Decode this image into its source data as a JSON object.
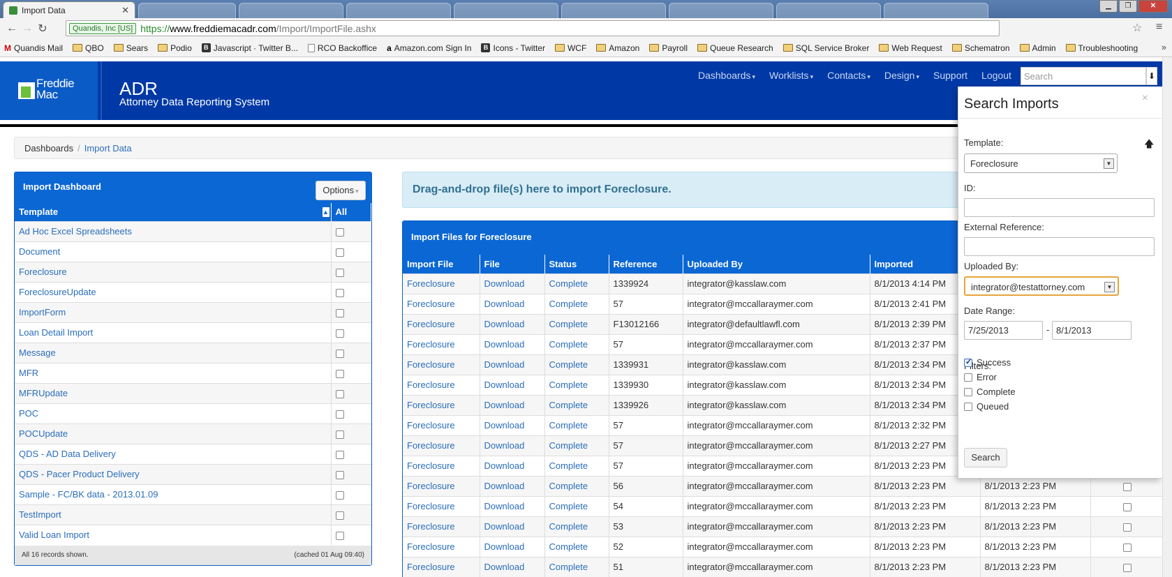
{
  "browser": {
    "active_tab": "Import Data",
    "ssl_label": "Quandis, Inc [US]",
    "url_scheme": "https://",
    "url_host": "www.freddiemacadr.com",
    "url_path": "/Import/ImportFile.ashx",
    "bookmarks": [
      {
        "label": "Quandis Mail",
        "icon": "gmail-icon"
      },
      {
        "label": "QBO",
        "icon": "folder-icon"
      },
      {
        "label": "Sears",
        "icon": "folder-icon"
      },
      {
        "label": "Podio",
        "icon": "folder-icon"
      },
      {
        "label": "Javascript · Twitter B...",
        "icon": "bootstrap-icon"
      },
      {
        "label": "RCO Backoffice",
        "icon": "page-icon"
      },
      {
        "label": "Amazon.com Sign In",
        "icon": "amazon-icon"
      },
      {
        "label": "Icons - Twitter",
        "icon": "bootstrap-icon"
      },
      {
        "label": "WCF",
        "icon": "folder-icon"
      },
      {
        "label": "Amazon",
        "icon": "folder-icon"
      },
      {
        "label": "Payroll",
        "icon": "folder-icon"
      },
      {
        "label": "Queue Research",
        "icon": "folder-icon"
      },
      {
        "label": "SQL Service Broker",
        "icon": "folder-icon"
      },
      {
        "label": "Web Request",
        "icon": "folder-icon"
      },
      {
        "label": "Schematron",
        "icon": "folder-icon"
      },
      {
        "label": "Admin",
        "icon": "folder-icon"
      },
      {
        "label": "Troubleshooting",
        "icon": "folder-icon"
      }
    ]
  },
  "header": {
    "logo_line1": "Freddie",
    "logo_line2": "Mac",
    "title": "ADR",
    "subtitle": "Attorney Data Reporting System",
    "nav": [
      "Dashboards",
      "Worklists",
      "Contacts",
      "Design",
      "Support",
      "Logout"
    ],
    "search_placeholder": "Search"
  },
  "breadcrumb": {
    "root": "Dashboards",
    "current": "Import Data"
  },
  "import_dashboard": {
    "title": "Import Dashboard",
    "options_label": "Options",
    "col_template": "Template",
    "col_all": "All",
    "templates": [
      "Ad Hoc Excel Spreadsheets",
      "Document",
      "Foreclosure",
      "ForeclosureUpdate",
      "ImportForm",
      "Loan Detail Import",
      "Message",
      "MFR",
      "MFRUpdate",
      "POC",
      "POCUpdate",
      "QDS - AD Data Delivery",
      "QDS - Pacer Product Delivery",
      "Sample - FC/BK data - 2013.01.09",
      "TestImport",
      "Valid Loan Import"
    ],
    "footer_left": "All 16 records shown.",
    "footer_right": "(cached 01 Aug 09:40)"
  },
  "dropzone_text": "Drag-and-drop file(s) here to import Foreclosure.",
  "import_files": {
    "title": "Import Files for Foreclosure",
    "columns": [
      "Import File",
      "File",
      "Status",
      "Reference",
      "Uploaded By",
      "Imported",
      "",
      ""
    ],
    "rows": [
      [
        "Foreclosure",
        "Download",
        "Complete",
        "1339924",
        "integrator@kasslaw.com",
        "8/1/2013 4:14 PM",
        "",
        ""
      ],
      [
        "Foreclosure",
        "Download",
        "Complete",
        "57",
        "integrator@mccallaraymer.com",
        "8/1/2013 2:41 PM",
        "",
        ""
      ],
      [
        "Foreclosure",
        "Download",
        "Complete",
        "F13012166",
        "integrator@defaultlawfl.com",
        "8/1/2013 2:39 PM",
        "",
        ""
      ],
      [
        "Foreclosure",
        "Download",
        "Complete",
        "57",
        "integrator@mccallaraymer.com",
        "8/1/2013 2:37 PM",
        "",
        ""
      ],
      [
        "Foreclosure",
        "Download",
        "Complete",
        "1339931",
        "integrator@kasslaw.com",
        "8/1/2013 2:34 PM",
        "",
        ""
      ],
      [
        "Foreclosure",
        "Download",
        "Complete",
        "1339930",
        "integrator@kasslaw.com",
        "8/1/2013 2:34 PM",
        "",
        ""
      ],
      [
        "Foreclosure",
        "Download",
        "Complete",
        "1339926",
        "integrator@kasslaw.com",
        "8/1/2013 2:34 PM",
        "",
        ""
      ],
      [
        "Foreclosure",
        "Download",
        "Complete",
        "57",
        "integrator@mccallaraymer.com",
        "8/1/2013 2:32 PM",
        "",
        ""
      ],
      [
        "Foreclosure",
        "Download",
        "Complete",
        "57",
        "integrator@mccallaraymer.com",
        "8/1/2013 2:27 PM",
        "",
        ""
      ],
      [
        "Foreclosure",
        "Download",
        "Complete",
        "57",
        "integrator@mccallaraymer.com",
        "8/1/2013 2:23 PM",
        "",
        ""
      ],
      [
        "Foreclosure",
        "Download",
        "Complete",
        "56",
        "integrator@mccallaraymer.com",
        "8/1/2013 2:23 PM",
        "8/1/2013 2:23 PM",
        ""
      ],
      [
        "Foreclosure",
        "Download",
        "Complete",
        "54",
        "integrator@mccallaraymer.com",
        "8/1/2013 2:23 PM",
        "8/1/2013 2:23 PM",
        ""
      ],
      [
        "Foreclosure",
        "Download",
        "Complete",
        "53",
        "integrator@mccallaraymer.com",
        "8/1/2013 2:23 PM",
        "8/1/2013 2:23 PM",
        ""
      ],
      [
        "Foreclosure",
        "Download",
        "Complete",
        "52",
        "integrator@mccallaraymer.com",
        "8/1/2013 2:23 PM",
        "8/1/2013 2:23 PM",
        ""
      ],
      [
        "Foreclosure",
        "Download",
        "Complete",
        "51",
        "integrator@mccallaraymer.com",
        "8/1/2013 2:23 PM",
        "8/1/2013 2:23 PM",
        ""
      ]
    ]
  },
  "search_imports": {
    "title": "Search Imports",
    "template_label": "Template:",
    "template_value": "Foreclosure",
    "id_label": "ID:",
    "id_value": "",
    "extref_label": "External Reference:",
    "extref_value": "",
    "uploaded_by_label": "Uploaded By:",
    "uploaded_by_value": "integrator@testattorney.com",
    "date_range_label": "Date Range:",
    "date_from": "7/25/2013",
    "date_sep": "-",
    "date_to": "8/1/2013",
    "filters_label": "Filters:",
    "filters": [
      {
        "label": "Success",
        "checked": true
      },
      {
        "label": "Error",
        "checked": false
      },
      {
        "label": "Complete",
        "checked": false
      },
      {
        "label": "Queued",
        "checked": false
      }
    ],
    "search_button": "Search"
  }
}
